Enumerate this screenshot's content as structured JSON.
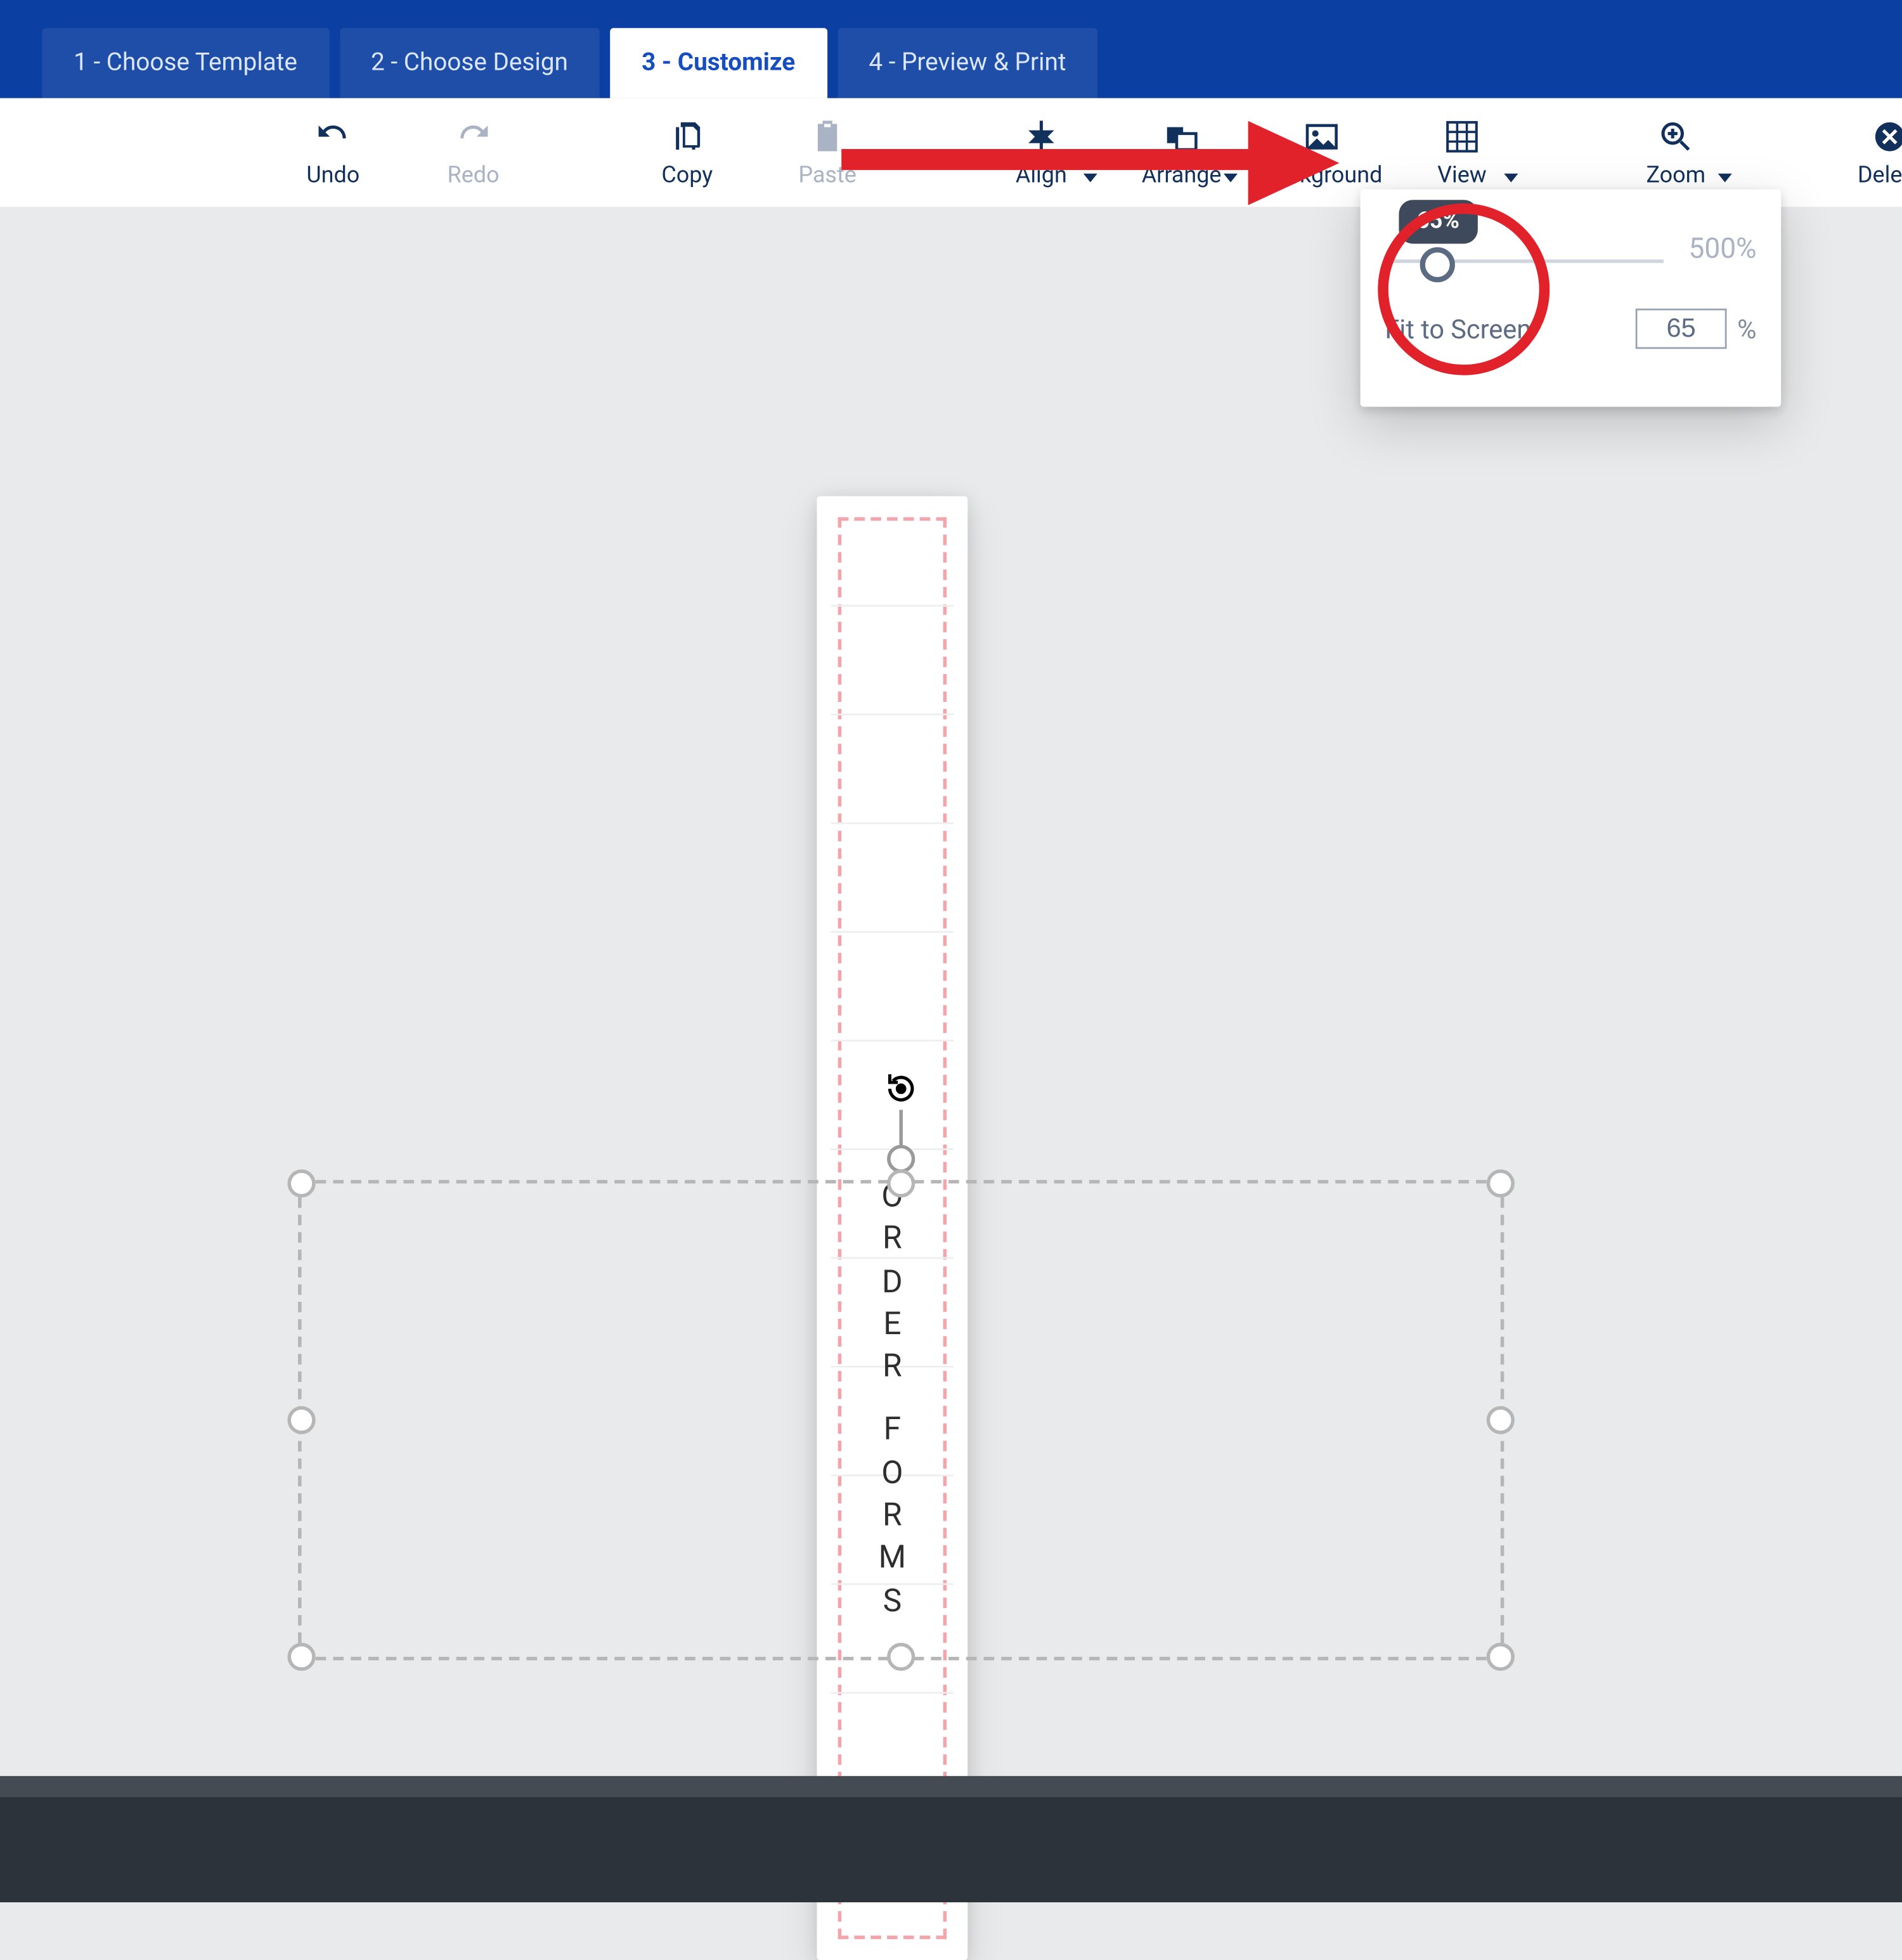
{
  "tabs": [
    {
      "label": "1 - Choose Template",
      "active": false
    },
    {
      "label": "2 - Choose Design",
      "active": false
    },
    {
      "label": "3 - Customize",
      "active": true
    },
    {
      "label": "4 - Preview & Print",
      "active": false
    }
  ],
  "toolbar": {
    "undo": "Undo",
    "redo": "Redo",
    "copy": "Copy",
    "paste": "Paste",
    "align": "Align",
    "arrange": "Arrange",
    "background": "Background",
    "view": "View",
    "zoom": "Zoom",
    "delete": "Delete"
  },
  "zoom_popover": {
    "value_pct": "65%",
    "max_label": "500%",
    "fit": "Fit to Screen",
    "input_value": "65",
    "suffix": "%"
  },
  "canvas_text": {
    "line1": "ORDER",
    "line2": "FORMS"
  }
}
